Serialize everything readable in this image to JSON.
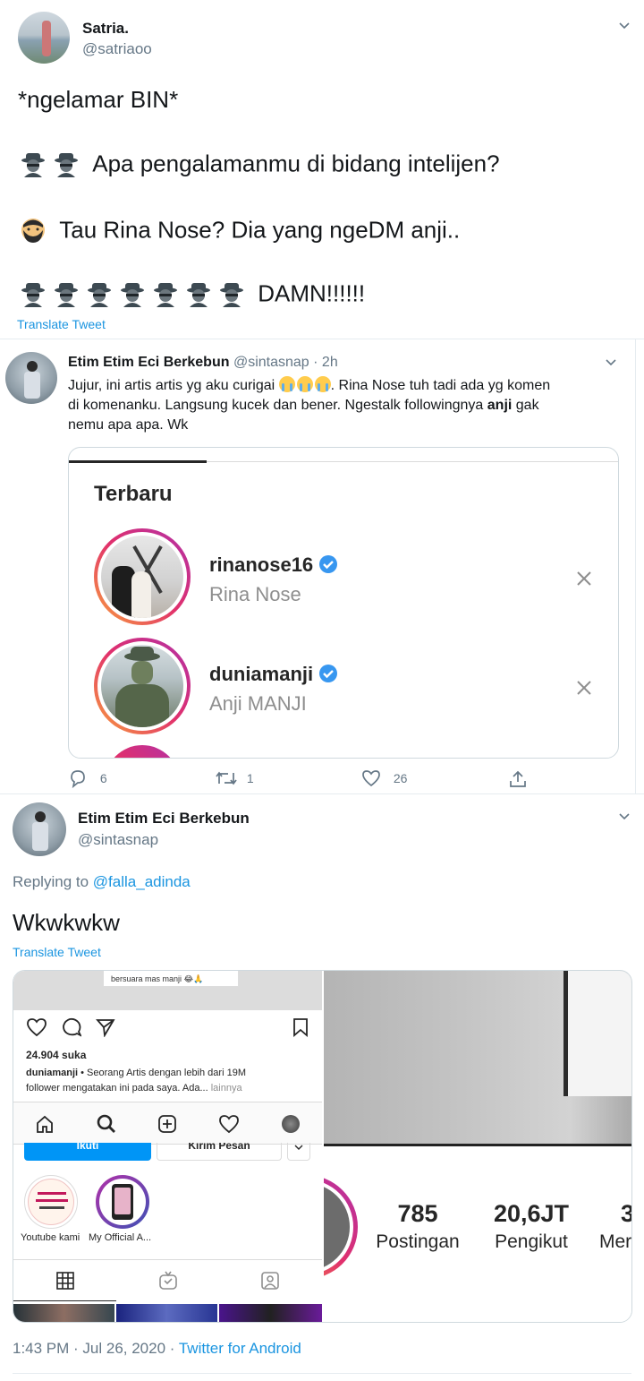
{
  "tweet1": {
    "display_name": "Satria.",
    "handle": "@satriaoo",
    "line1": "*ngelamar BIN*",
    "line2": "Apa pengalamanmu di bidang intelijen?",
    "line3": "Tau Rina Nose? Dia yang ngeDM anji..",
    "line4": "DAMN!!!!!!",
    "translate": "Translate Tweet"
  },
  "quoted": {
    "display_name": "Etim Etim Eci Berkebun",
    "handle": "@sintasnap",
    "time": "· 2h",
    "text_a": "Jujur, ini artis artis yg aku curigai",
    "text_b": ". Rina Nose tuh tadi ada yg komen",
    "text_c": "di komenanku. Langsung kucek dan bener. Ngestalk followingnya",
    "text_bold": "anji",
    "text_d": "gak",
    "text_e": "nemu apa apa. Wk",
    "card": {
      "title": "Terbaru",
      "items": [
        {
          "username": "rinanose16",
          "name": "Rina Nose"
        },
        {
          "username": "duniamanji",
          "name": "Anji MANJI"
        }
      ]
    },
    "actions": {
      "replies": "6",
      "retweets": "1",
      "likes": "26"
    }
  },
  "tweet2": {
    "display_name": "Etim Etim Eci Berkebun",
    "handle": "@sintasnap",
    "replying_prefix": "Replying to",
    "replying_to": "@falla_adinda",
    "text": "Wkwkwkw",
    "translate": "Translate Tweet",
    "footer_time": "1:43 PM · Jul 26, 2020 ·",
    "footer_client": "Twitter for Android"
  },
  "ig_left": {
    "top_comment": "bersuara mas manji 😂🙏",
    "likes": "24.904 suka",
    "caption_user": "duniamanji",
    "caption_text": " • Seorang Artis dengan lebih dari 19M",
    "caption_text2": "follower mengatakan ini pada saya. Ada...",
    "caption_more": " lainnya",
    "follow_btn": "Ikuti",
    "message_btn": "Kirim Pesan",
    "highlights": [
      "Youtube kami",
      "My Official A..."
    ]
  },
  "ig_right": {
    "stats": [
      {
        "value": "785",
        "label": "Postingan"
      },
      {
        "value": "20,6JT",
        "label": "Pengikut"
      },
      {
        "value": "3",
        "label": "Mer"
      }
    ]
  },
  "colors": {
    "link": "#1b95e0",
    "text": "#14171a",
    "muted": "#657786",
    "verified": "#3897f0",
    "ig_blue": "#0095f6"
  }
}
